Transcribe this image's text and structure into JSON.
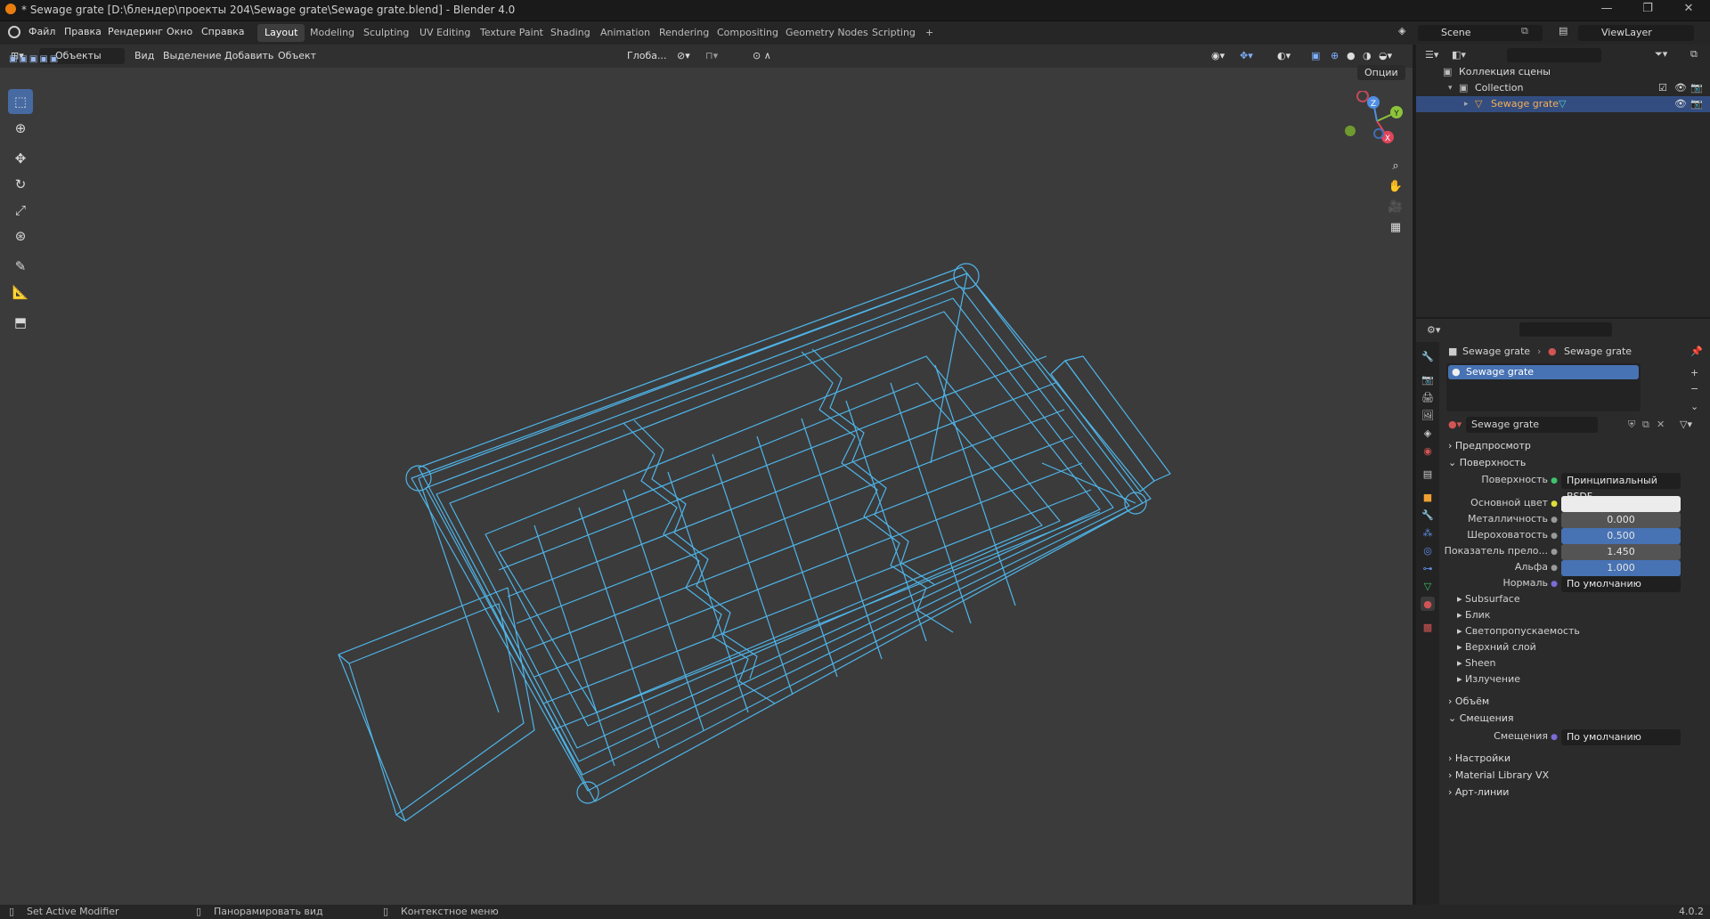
{
  "window": {
    "title": "* Sewage grate [D:\\блендер\\проекты 204\\Sewage grate\\Sewage grate.blend] - Blender 4.0"
  },
  "menus": [
    "Файл",
    "Правка",
    "Рендеринг",
    "Окно",
    "Справка"
  ],
  "workspaces": [
    "Layout",
    "Modeling",
    "Sculpting",
    "UV Editing",
    "Texture Paint",
    "Shading",
    "Animation",
    "Rendering",
    "Compositing",
    "Geometry Nodes",
    "Scripting"
  ],
  "active_workspace": "Layout",
  "scene": {
    "name": "Scene",
    "view_layer": "ViewLayer"
  },
  "viewport": {
    "mode": "Объекты",
    "menu": [
      "Вид",
      "Выделение",
      "Добавить",
      "Объект"
    ],
    "orientation": "Глоба...",
    "options": "Опции",
    "wire_color": "#4fb4e8",
    "bg_color": "#3b3b3b"
  },
  "gizmo": {
    "y": "Y",
    "z": "Z",
    "x": "X"
  },
  "outliner": {
    "root": "Коллекция сцены",
    "collection": "Collection",
    "object": "Sewage grate"
  },
  "properties": {
    "breadcrumb_object": "Sewage grate",
    "breadcrumb_material": "Sewage grate",
    "slot": "Sewage grate",
    "material_name": "Sewage grate",
    "panels": {
      "preview": "Предпросмотр",
      "surface": "Поверхность",
      "volume": "Объём",
      "displacement": "Смещения",
      "settings": "Настройки",
      "material_library": "Material Library VX",
      "lineart": "Арт-линии"
    },
    "surface_label": "Поверхность",
    "surface_value": "Принципиальный BSDF",
    "base_color_label": "Основной цвет",
    "base_color": "#ececec",
    "metallic_label": "Металличность",
    "metallic": "0.000",
    "roughness_label": "Шероховатость",
    "roughness": "0.500",
    "ior_label": "Показатель прело...",
    "ior": "1.450",
    "alpha_label": "Альфа",
    "alpha": "1.000",
    "normal_label": "Нормаль",
    "normal": "По умолчанию",
    "subpanels": [
      "Subsurface",
      "Блик",
      "Светопропускаемость",
      "Верхний слой",
      "Sheen",
      "Излучение"
    ],
    "displacement_label": "Смещения",
    "displacement_value": "По умолчанию"
  },
  "status": {
    "left": "Set Active Modifier",
    "middle": "Панорамировать вид",
    "right": "Контекстное меню",
    "version": "4.0.2"
  }
}
